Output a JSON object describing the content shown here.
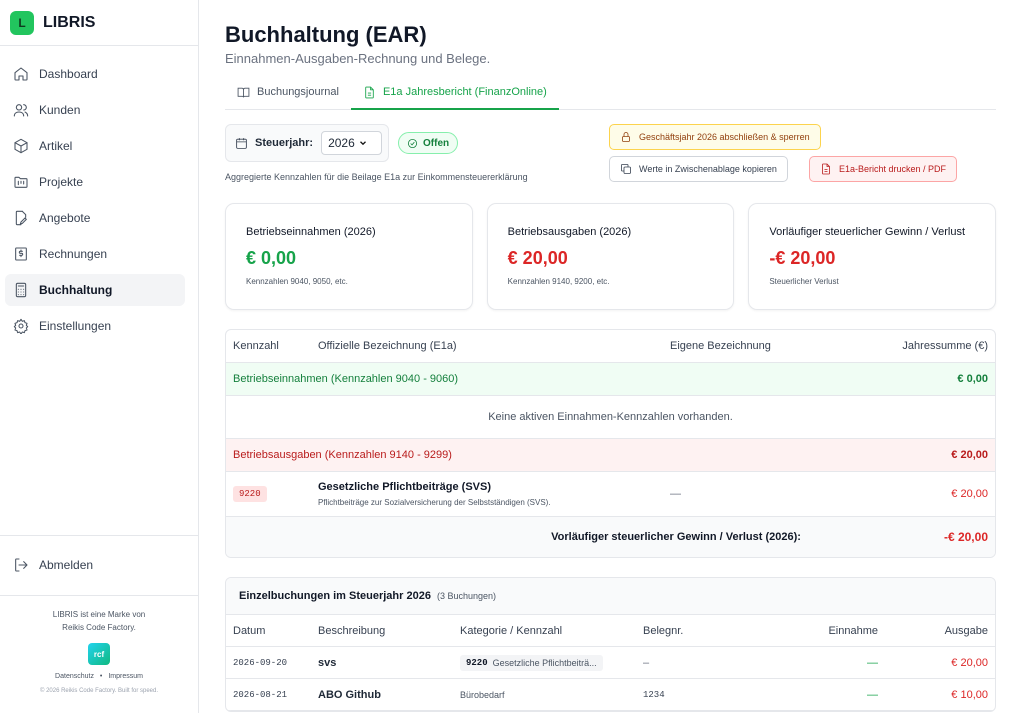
{
  "app": {
    "logo_letter": "L",
    "name": "LIBRIS"
  },
  "sidebar": {
    "items": [
      {
        "label": "Dashboard",
        "icon": "home-icon"
      },
      {
        "label": "Kunden",
        "icon": "users-icon"
      },
      {
        "label": "Artikel",
        "icon": "box-icon"
      },
      {
        "label": "Projekte",
        "icon": "folder-kanban-icon"
      },
      {
        "label": "Angebote",
        "icon": "file-edit-icon"
      },
      {
        "label": "Rechnungen",
        "icon": "receipt-icon"
      },
      {
        "label": "Buchhaltung",
        "icon": "calculator-icon",
        "active": true
      },
      {
        "label": "Einstellungen",
        "icon": "gear-icon"
      }
    ],
    "logout": "Abmelden",
    "footer": {
      "brand_line1": "LIBRIS ist eine Marke von",
      "brand_line2": "Reikis Code Factory.",
      "logo_text": "rcf",
      "privacy": "Datenschutz",
      "sep": "•",
      "imprint": "Impressum",
      "copyright": "© 2026 Reikis Code Factory. Built for speed."
    }
  },
  "page": {
    "title": "Buchhaltung (EAR)",
    "subtitle": "Einnahmen-Ausgaben-Rechnung und Belege."
  },
  "tabs": [
    {
      "label": "Buchungsjournal"
    },
    {
      "label": "E1a Jahresbericht (FinanzOnline)",
      "active": true
    }
  ],
  "controls": {
    "year_label": "Steuerjahr:",
    "year_value": "2026",
    "status": "Offen",
    "hint": "Aggregierte Kennzahlen für die Beilage E1a zur Einkommensteuererklärung",
    "lock_button": "Geschäftsjahr 2026 abschließen & sperren",
    "copy_button": "Werte in Zwischenablage kopieren",
    "pdf_button": "E1a-Bericht drucken / PDF"
  },
  "cards": [
    {
      "title": "Betriebseinnahmen (2026)",
      "value": "€ 0,00",
      "sub": "Kennzahlen 9040, 9050, etc."
    },
    {
      "title": "Betriebsausgaben (2026)",
      "value": "€ 20,00",
      "sub": "Kennzahlen 9140, 9200, etc."
    },
    {
      "title": "Vorläufiger steuerlicher Gewinn / Verlust",
      "value": "-€ 20,00",
      "sub": "Steuerlicher Verlust"
    }
  ],
  "e1a_table": {
    "headers": [
      "Kennzahl",
      "Offizielle Bezeichnung (E1a)",
      "Eigene Bezeichnung",
      "Jahressumme (€)"
    ],
    "income_section": {
      "label": "Betriebseinnahmen (Kennzahlen 9040 - 9060)",
      "total": "€ 0,00"
    },
    "income_empty": "Keine aktiven Einnahmen-Kennzahlen vorhanden.",
    "expense_section": {
      "label": "Betriebsausgaben (Kennzahlen 9140 - 9299)",
      "total": "€ 20,00"
    },
    "expense_rows": [
      {
        "code": "9220",
        "title": "Gesetzliche Pflichtbeiträge (SVS)",
        "subtitle": "Pflichtbeiträge zur Sozialversicherung der Selbstständigen (SVS).",
        "custom": "—",
        "amount": "€ 20,00"
      }
    ],
    "total_label": "Vorläufiger steuerlicher Gewinn / Verlust (2026):",
    "total_value": "-€ 20,00"
  },
  "bookings": {
    "title": "Einzelbuchungen im Steuerjahr 2026",
    "count": "(3 Buchungen)",
    "headers": [
      "Datum",
      "Beschreibung",
      "Kategorie / Kennzahl",
      "Belegnr.",
      "Einnahme",
      "Ausgabe"
    ],
    "rows": [
      {
        "date": "2026-09-20",
        "desc": "svs",
        "cat_code": "9220",
        "cat_label": "Gesetzliche Pflichtbeiträ...",
        "doc": "–",
        "income": "—",
        "expense": "€ 20,00"
      },
      {
        "date": "2026-08-21",
        "desc": "ABO Github",
        "cat_code": "",
        "cat_label": "Bürobedarf",
        "doc": "1234",
        "income": "—",
        "expense": "€ 10,00"
      }
    ]
  },
  "colors": {
    "brand": "#22c55e",
    "income": "#16a34a",
    "expense": "#dc2626"
  }
}
